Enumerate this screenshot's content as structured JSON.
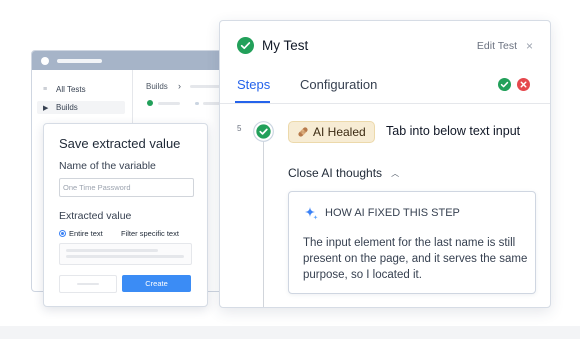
{
  "back_window": {
    "nav_items": [
      {
        "label": "All Tests",
        "icon": "list-icon"
      },
      {
        "label": "Builds",
        "icon": "caret-right-icon"
      }
    ],
    "breadcrumb": "Builds"
  },
  "save_dialog": {
    "title": "Save extracted value",
    "variable_label": "Name of the variable",
    "variable_placeholder": "One Time Password",
    "extracted_label": "Extracted value",
    "radio_options": [
      {
        "label": "Entire text",
        "selected": true
      },
      {
        "label": "Filter specific text",
        "selected": false
      }
    ],
    "create_label": "Create"
  },
  "panel": {
    "title": "My Test",
    "edit_label": "Edit Test",
    "close_glyph": "×",
    "tabs": [
      {
        "label": "Steps",
        "active": true
      },
      {
        "label": "Configuration",
        "active": false
      }
    ],
    "step": {
      "number": "5",
      "badge": "AI Healed",
      "text": "Tab into below text input"
    },
    "thoughts_toggle": "Close AI thoughts",
    "ai_card": {
      "heading": "HOW AI FIXED THIS STEP",
      "body": "The input element for the last name is still present on the page, and it serves the same purpose, so I located it."
    }
  },
  "colors": {
    "accent": "#2563eb",
    "success": "#22a05a",
    "error": "#e5484d",
    "badge_bg": "#f7ecd4",
    "button": "#3b8cf5"
  }
}
